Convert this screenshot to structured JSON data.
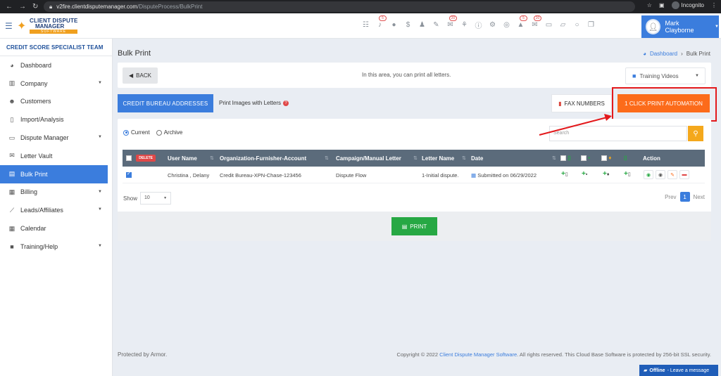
{
  "browser": {
    "url_domain": "v2fire.clientdisputemanager.com",
    "url_path": "/DisputeProcess/BulkPrint",
    "profile": "Incognito"
  },
  "header": {
    "logo_line1": "CLIENT DISPUTE",
    "logo_line2": "MANAGER",
    "logo_line3": "SOFTWARE",
    "icons": [
      {
        "name": "tasks-icon",
        "badge": ""
      },
      {
        "name": "bell-icon",
        "badge": "5"
      },
      {
        "name": "client-icon",
        "badge": ""
      },
      {
        "name": "dollar-icon",
        "badge": ""
      },
      {
        "name": "affiliate-icon",
        "badge": ""
      },
      {
        "name": "edit-icon",
        "badge": ""
      },
      {
        "name": "mail-icon",
        "badge": "20"
      },
      {
        "name": "org-chart-icon",
        "badge": ""
      },
      {
        "name": "info-icon",
        "badge": ""
      },
      {
        "name": "settings-icon",
        "badge": ""
      },
      {
        "name": "dollar-circle-icon",
        "badge": ""
      },
      {
        "name": "warning-icon",
        "badge": "5"
      },
      {
        "name": "message-icon",
        "badge": "20"
      },
      {
        "name": "money-icon",
        "badge": ""
      },
      {
        "name": "inbox-icon",
        "badge": ""
      },
      {
        "name": "chat-icon",
        "badge": ""
      },
      {
        "name": "copy-icon",
        "badge": ""
      }
    ],
    "user_name": "Mark Clayborne"
  },
  "sidebar": {
    "team": "CREDIT SCORE SPECIALIST TEAM",
    "items": [
      {
        "label": "Dashboard",
        "icon": "pie-chart-icon",
        "caret": false
      },
      {
        "label": "Company",
        "icon": "building-icon",
        "caret": true
      },
      {
        "label": "Customers",
        "icon": "users-icon",
        "caret": false
      },
      {
        "label": "Import/Analysis",
        "icon": "file-icon",
        "caret": false
      },
      {
        "label": "Dispute Manager",
        "icon": "laptop-icon",
        "caret": true
      },
      {
        "label": "Letter Vault",
        "icon": "envelope-open-icon",
        "caret": false
      },
      {
        "label": "Bulk Print",
        "icon": "printer-icon",
        "caret": false
      },
      {
        "label": "Billing",
        "icon": "billing-icon",
        "caret": true
      },
      {
        "label": "Leads/Affiliates",
        "icon": "chart-icon",
        "caret": true
      },
      {
        "label": "Calendar",
        "icon": "calendar-icon",
        "caret": false
      },
      {
        "label": "Training/Help",
        "icon": "video-icon",
        "caret": true
      }
    ]
  },
  "page": {
    "title": "Bulk Print",
    "breadcrumb_home": "Dashboard",
    "breadcrumb_current": "Bulk Print",
    "back_label": "BACK",
    "hint": "In this area, you can print all letters.",
    "training_videos": "Training Videos",
    "cba_button": "CREDIT BUREAU ADDRESSES",
    "print_images_label": "Print Images with Letters",
    "fax_button": "FAX NUMBERS",
    "auto_button": "1 CLICK PRINT AUTOMATION",
    "radio_current": "Current",
    "radio_archive": "Archive",
    "search_placeholder": "Search",
    "delete_label": "DELETE",
    "columns": {
      "user_name": "User Name",
      "org": "Organization-Furnisher-Account",
      "campaign": "Campaign/Manual Letter",
      "letter_name": "Letter Name",
      "date": "Date",
      "action": "Action"
    },
    "row": {
      "user_name": "Christina , Delany",
      "org": "Credit Bureau-XPN-Chase-123456",
      "campaign": "Dispute Flow",
      "letter_name": "1-Initial dispute.",
      "date": "Submitted on 06/29/2022"
    },
    "show_label": "Show",
    "show_value": "10",
    "prev": "Prev",
    "page_num": "1",
    "next": "Next",
    "print_button": "PRINT"
  },
  "footer": {
    "protected": "Protected by Armor.",
    "copyright_pre": "Copyright © 2022",
    "copyright_link": "Client Dispute Manager Software",
    "copyright_post": ". All rights reserved. This Cloud Base Software is protected by 256-bit SSL security.",
    "chat_status": "Offline",
    "chat_action": "- Leave a message"
  }
}
